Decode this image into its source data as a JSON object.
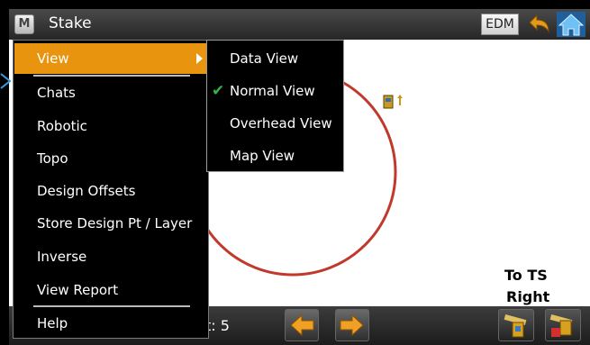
{
  "title": "Stake",
  "menu_icon_letter": "M",
  "edm_label": "EDM",
  "main_menu": {
    "items": [
      {
        "label": "View",
        "active": true
      },
      {
        "label": "Chats"
      },
      {
        "label": "Robotic"
      },
      {
        "label": "Topo"
      },
      {
        "label": "Design Offsets"
      },
      {
        "label": "Store Design Pt / Layer"
      },
      {
        "label": "Inverse"
      },
      {
        "label": "View Report"
      },
      {
        "label": "Help"
      }
    ]
  },
  "view_submenu": {
    "items": [
      {
        "label": "Data View",
        "checked": false
      },
      {
        "label": "Normal View",
        "checked": true
      },
      {
        "label": "Overhead View",
        "checked": false
      },
      {
        "label": "Map View",
        "checked": false
      }
    ]
  },
  "map": {
    "to_label": "To TS",
    "direction_label": "Right"
  },
  "footer": {
    "point_label": "t: 5"
  },
  "icons": {
    "menu": "menu-icon",
    "undo": "undo-arrow-icon",
    "home": "home-icon",
    "previous": "left-arrow-icon",
    "next": "right-arrow-icon",
    "check": "checkmark-icon",
    "instrument": "total-station-icon",
    "tool_1": "stake-tool-icon",
    "tool_2": "store-tool-icon"
  },
  "colors": {
    "accent": "#e8940f",
    "circle": "#c0392b",
    "check": "#38b34a",
    "home": "#3a9be0"
  }
}
